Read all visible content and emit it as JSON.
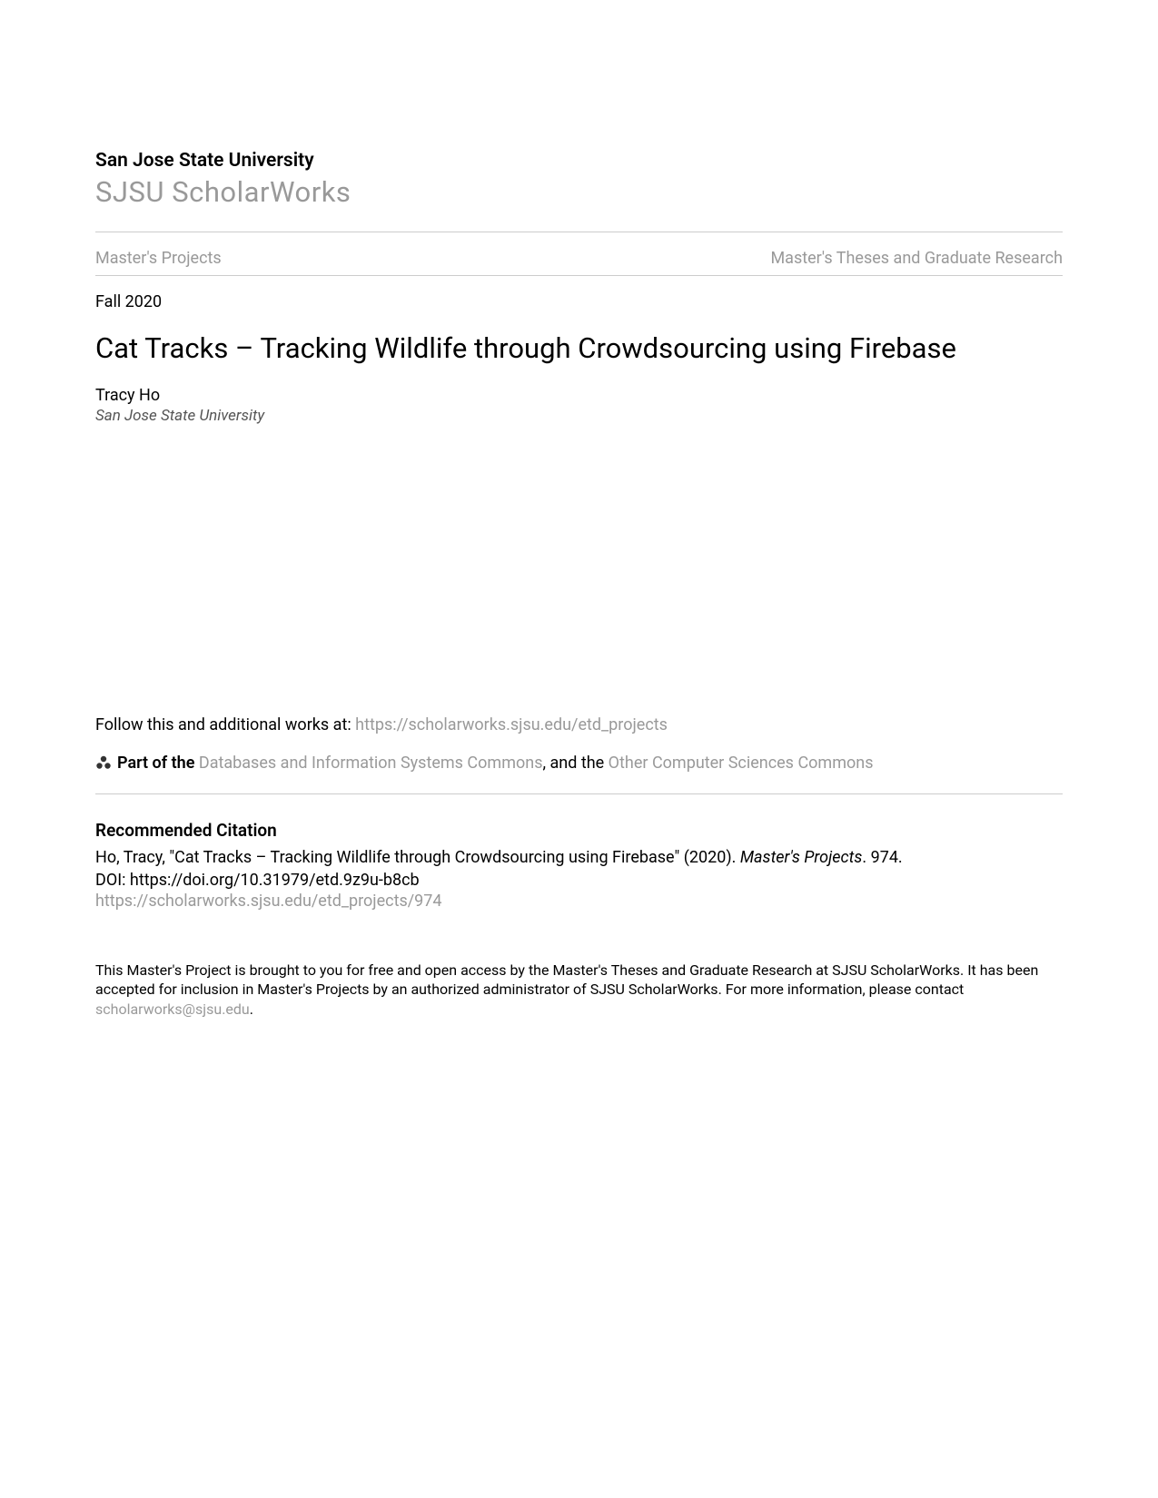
{
  "header": {
    "university": "San Jose State University",
    "repository": "SJSU ScholarWorks"
  },
  "breadcrumb": {
    "left": "Master's Projects",
    "right": "Master's Theses and Graduate Research"
  },
  "date": "Fall 2020",
  "title": "Cat Tracks – Tracking Wildlife through Crowdsourcing using Firebase",
  "author": {
    "name": "Tracy Ho",
    "affiliation": "San Jose State University"
  },
  "follow": {
    "prefix": "Follow this and additional works at: ",
    "url": "https://scholarworks.sjsu.edu/etd_projects"
  },
  "part_of": {
    "label": "Part of the ",
    "link1": "Databases and Information Systems Commons",
    "middle": ", and the ",
    "link2": "Other Computer Sciences Commons"
  },
  "citation": {
    "heading": "Recommended Citation",
    "text_prefix": "Ho, Tracy, \"Cat Tracks – Tracking Wildlife through Crowdsourcing using Firebase\" (2020). ",
    "series": "Master's Projects",
    "number": ". 974.",
    "doi": "DOI: https://doi.org/10.31979/etd.9z9u-b8cb",
    "url": "https://scholarworks.sjsu.edu/etd_projects/974"
  },
  "footer": {
    "text_prefix": "This Master's Project is brought to you for free and open access by the Master's Theses and Graduate Research at SJSU ScholarWorks. It has been accepted for inclusion in Master's Projects by an authorized administrator of SJSU ScholarWorks. For more information, please contact ",
    "email": "scholarworks@sjsu.edu",
    "suffix": "."
  }
}
